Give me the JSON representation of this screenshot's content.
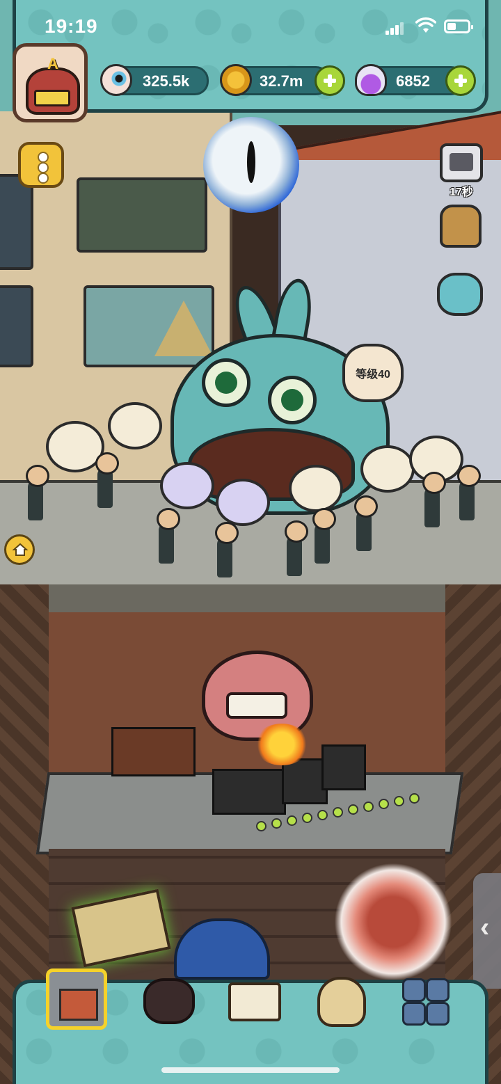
{
  "status_bar": {
    "time": "19:19"
  },
  "profile": {
    "avatar_letter": "A"
  },
  "resources": [
    {
      "icon": "eyeball-icon",
      "value": "325.5k",
      "has_plus": false
    },
    {
      "icon": "gold-coin-icon",
      "value": "32.7m",
      "has_plus": true
    },
    {
      "icon": "purple-potion-icon",
      "value": "6852",
      "has_plus": true
    }
  ],
  "side_buttons": {
    "ad_tv_timer": "17秒"
  },
  "scene": {
    "restaurant_level": "等级40"
  },
  "bottom_nav": {
    "items": [
      {
        "icon": "shop-icon",
        "selected": true
      },
      {
        "icon": "monster-chef-icon",
        "selected": false
      },
      {
        "icon": "recipe-book-icon",
        "selected": false
      },
      {
        "icon": "money-bag-icon",
        "selected": false
      },
      {
        "icon": "grid-menu-icon",
        "selected": false
      }
    ]
  },
  "colors": {
    "hud_teal": "#74c3c0",
    "hud_border": "#1e4245",
    "plus_green": "#a8d63a",
    "gold": "#f2c33a",
    "selected_outline": "#f5d22a"
  }
}
